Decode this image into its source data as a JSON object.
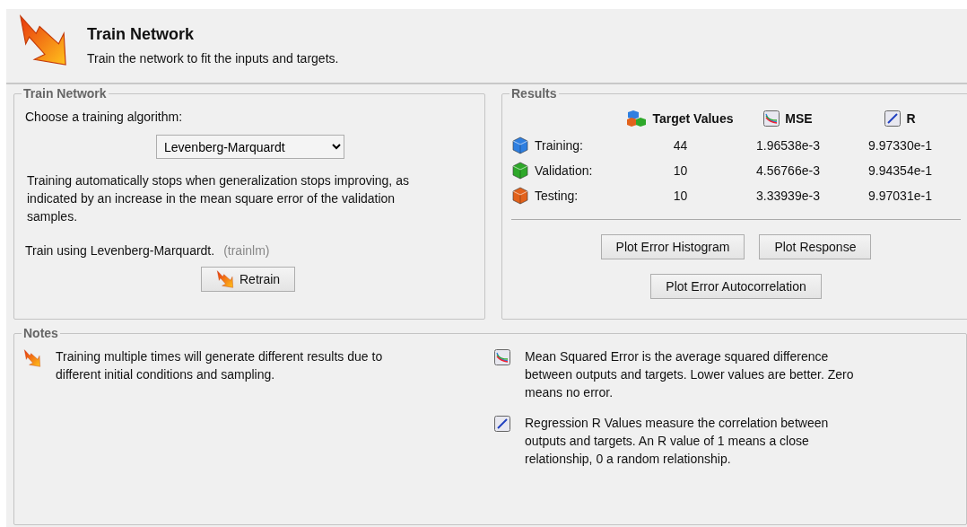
{
  "header": {
    "title": "Train Network",
    "subtitle": "Train the network to fit the inputs and targets."
  },
  "train_panel": {
    "legend": "Train Network",
    "prompt": "Choose a training algorithm:",
    "algorithm": "Levenberg-Marquardt",
    "description": "Training automatically stops when generalization stops improving, as indicated by an increase in the mean square error of the validation samples.",
    "train_using": "Train using Levenberg-Marquardt.",
    "function_name": "(trainlm)",
    "retrain_button": "Retrain"
  },
  "results": {
    "legend": "Results",
    "columns": [
      {
        "label": "Target Values",
        "kind": "cubes"
      },
      {
        "label": "MSE",
        "kind": "mse"
      },
      {
        "label": "R",
        "kind": "r"
      }
    ],
    "rows": [
      {
        "label": "Training:",
        "color": "#2f7fe0",
        "target": "44",
        "mse": "1.96538e-3",
        "r": "9.97330e-1"
      },
      {
        "label": "Validation:",
        "color": "#2ea82a",
        "target": "10",
        "mse": "4.56766e-3",
        "r": "9.94354e-1"
      },
      {
        "label": "Testing:",
        "color": "#e2621b",
        "target": "10",
        "mse": "3.33939e-3",
        "r": "9.97031e-1"
      }
    ],
    "buttons": [
      "Plot Error Histogram",
      "Plot Response",
      "Plot Error Autocorrelation"
    ]
  },
  "notes": {
    "legend": "Notes",
    "items": [
      {
        "kind": "train",
        "text": "Training multiple times will generate different results due to different initial conditions and sampling."
      },
      {
        "kind": "mse",
        "text": "Mean Squared Error is the average squared difference between outputs and targets. Lower values are better. Zero means no error."
      },
      {
        "kind": "r",
        "text": "Regression R Values measure the correlation between outputs and targets. An R value of 1 means a close relationship, 0 a random relationship."
      }
    ]
  }
}
